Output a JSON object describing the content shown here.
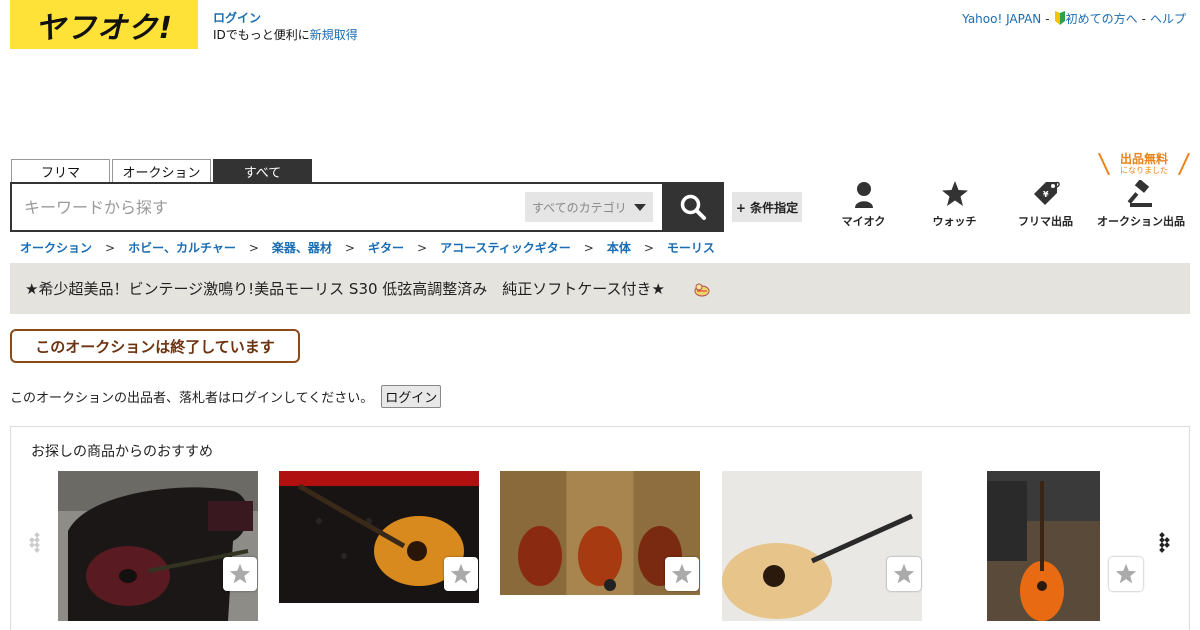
{
  "header": {
    "logo_text": "ヤフオク!",
    "login_label": "ログイン",
    "login_prompt": "IDでもっと便利に",
    "register_label": "新規取得",
    "links": {
      "yahoo": "Yahoo! JAPAN",
      "beginner": "初めての方へ",
      "help": "ヘルプ",
      "sep": "-"
    }
  },
  "tabs": [
    {
      "label": "フリマ",
      "active": false
    },
    {
      "label": "オークション",
      "active": false
    },
    {
      "label": "すべて",
      "active": true
    }
  ],
  "search": {
    "placeholder": "キーワードから探す",
    "category_label": "すべてのカテゴリ",
    "condition_label": "+ 条件指定"
  },
  "nav_icons": [
    {
      "label": "マイオク",
      "icon": "person-icon"
    },
    {
      "label": "ウォッチ",
      "icon": "star-icon"
    },
    {
      "label": "フリマ出品",
      "icon": "price-tag-icon"
    },
    {
      "label": "オークション出品",
      "icon": "gavel-icon"
    }
  ],
  "free_badge": {
    "text": "出品無料",
    "sub": "になりました"
  },
  "breadcrumb": [
    "オークション",
    "ホビー、カルチャー",
    "楽器、器材",
    "ギター",
    "アコースティックギター",
    "本体",
    "モーリス"
  ],
  "breadcrumb_sep": ">",
  "item": {
    "title": "★希少超美品！ビンテージ激鳴り!美品モーリス S30 低弦高調整済み　純正ソフトケース付き★"
  },
  "status": {
    "ended_label": "このオークションは終了しています",
    "login_note": "このオークションの出品者、落札者はログインしてください。",
    "login_button": "ログイン"
  },
  "recommendations": {
    "heading": "お探しの商品からのおすすめ",
    "items": [
      {
        "image": "guitar-in-case"
      },
      {
        "image": "guitar-on-sofa"
      },
      {
        "image": "guitars-on-wall"
      },
      {
        "image": "natural-guitar"
      },
      {
        "image": "orange-guitar"
      }
    ]
  },
  "colors": {
    "brand_yellow": "#ffe237",
    "link_blue": "#1a6cb3",
    "ended_brown": "#8a4a1a",
    "free_orange": "#e8821a"
  }
}
